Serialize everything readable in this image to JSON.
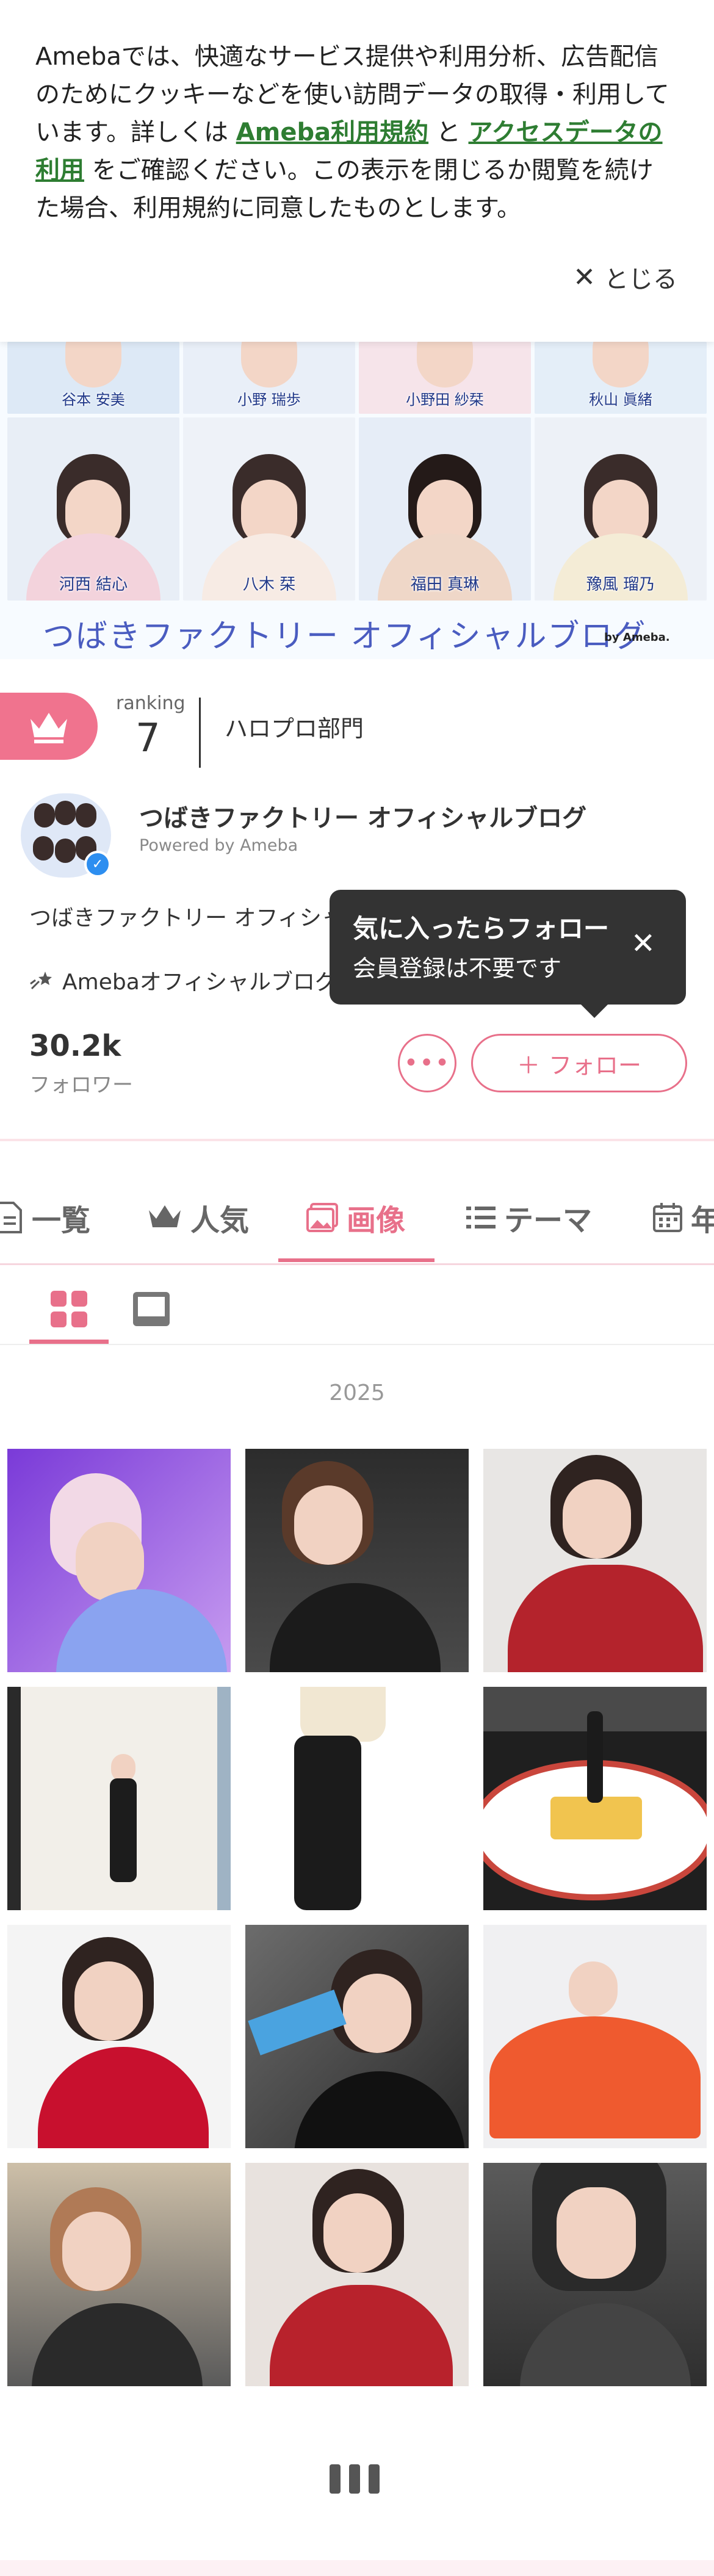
{
  "cookie": {
    "text_1": "Amebaでは、快適なサービス提供や利用分析、広告配信のためにクッキーなどを使い訪問データの取得・利用しています。詳しくは ",
    "link_terms": "Ameba利用規約",
    "text_2": " と ",
    "link_access": "アクセスデータの利用",
    "text_3": " をご確認ください。この表示を閉じるか閲覧を続けた場合、利用規約に同意したものとします。",
    "close_label": "とじる"
  },
  "banner": {
    "top_names": [
      "谷本 安美",
      "小野 瑞歩",
      "小野田 紗栞",
      "秋山 眞緒"
    ],
    "mid_names": [
      "河西 結心",
      "八木 栞",
      "福田 真琳",
      "豫風 瑠乃"
    ],
    "title": "つばきファクトリー オフィシャルブログ",
    "by": "by Ameba."
  },
  "ranking": {
    "label": "ranking",
    "number": "7",
    "department": "ハロプロ部門"
  },
  "blog": {
    "title": "つばきファクトリー オフィシャルブログ",
    "powered": "Powered by Ameba",
    "description": "つばきファクトリー オフィシャ",
    "official": "Amebaオフィシャルブログ"
  },
  "tooltip": {
    "title": "気に入ったらフォロー",
    "subtitle": "会員登録は不要です"
  },
  "follow": {
    "count": "30.2k",
    "label": "フォロワー",
    "button": "フォロー"
  },
  "tabs": [
    {
      "label": "一覧"
    },
    {
      "label": "人気"
    },
    {
      "label": "画像"
    },
    {
      "label": "テーマ"
    },
    {
      "label": "年"
    }
  ],
  "active_tab": "画像",
  "year": "2025",
  "colors": {
    "accent": "#e8708a",
    "crown_bg": "#f0738e",
    "banner_title": "#4a5cc0"
  }
}
